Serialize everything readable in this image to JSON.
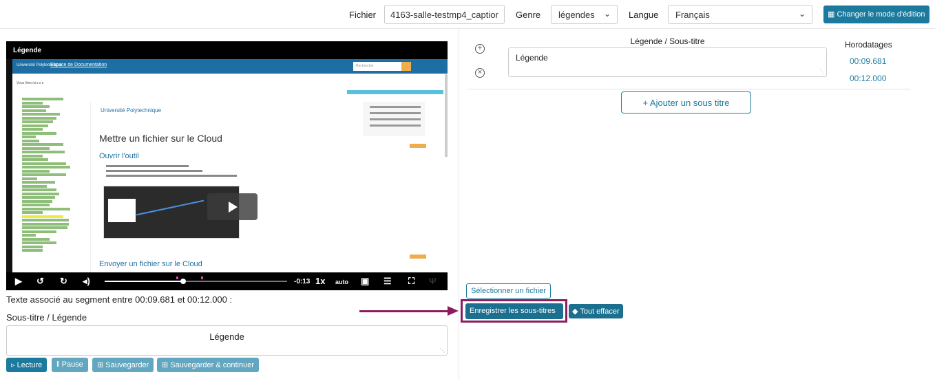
{
  "header": {
    "file_label": "Fichier",
    "file_value": "4163-salle-testmp4_captior",
    "genre_label": "Genre",
    "genre_value": "légendes",
    "langue_label": "Langue",
    "langue_value": "Français",
    "mode_button": "Changer le mode d'édition"
  },
  "video": {
    "title": "Légende",
    "site_title": "Espace de Documentation",
    "search_placeholder": "Rechercher",
    "page_heading": "Mettre un fichier sur le Cloud",
    "section_1": "Ouvrir l'outil",
    "section_2": "Envoyer un fichier sur le Cloud",
    "university": "Université Polytechnique",
    "time_remaining": "-0:13",
    "speed": "1x",
    "quality": "auto",
    "progress_fraction": 0.43
  },
  "segment": {
    "text": "Texte associé au segment entre 00:09.681 et 00:12.000 :",
    "subtitle_label": "Sous-titre / Légende",
    "subtitle_value": "Légende"
  },
  "actions": {
    "play": "Lecture",
    "pause": "Pause",
    "save": "Sauvegarder",
    "save_continue": "Sauvegarder & continuer"
  },
  "editor": {
    "column_caption": "Légende / Sous-titre",
    "column_times": "Horodatages",
    "row_caption": "Légende",
    "start_time": "00:09.681",
    "end_time": "00:12.000",
    "add_button": "+ Ajouter un sous titre",
    "select_file": "Sélectionner un fichier",
    "save_subtitles": "Enregistrer les sous-titres",
    "clear_all": "Tout effacer"
  }
}
